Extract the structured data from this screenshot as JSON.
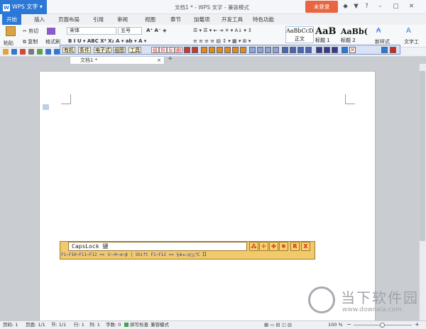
{
  "app": {
    "name": "WPS 文字",
    "doc_title": "文档1 * - WPS 文字 - 兼容模式",
    "login": "未登录"
  },
  "tabs": [
    "开始",
    "插入",
    "页面布局",
    "引用",
    "审阅",
    "视图",
    "章节",
    "加载项",
    "开发工具",
    "特色功能"
  ],
  "ribbon": {
    "paste": "粘贴",
    "cut": "剪切",
    "copy": "复制",
    "format_painter": "格式刷",
    "font_name": "宋体",
    "font_size": "五号",
    "styles": [
      {
        "preview": "AaBbCcD",
        "name": "正文"
      },
      {
        "preview": "AaB",
        "name": "标题 1"
      },
      {
        "preview": "AaBb(",
        "name": "标题 2"
      }
    ],
    "new_style": "新样式",
    "text_tools": "文字工"
  },
  "doc_tab": {
    "label": "文档1 *"
  },
  "ime_toolbar": {
    "buttons": [
      "有机",
      "条件",
      "电子式",
      "组图",
      "工具"
    ],
    "red_items": [
      "组",
      "拆",
      "反",
      "删"
    ]
  },
  "ime_candidate": {
    "input": "CapsLock 键",
    "hint": "F1~F10~F11~F12  => ①~⑩~α~β  |  Shift F1~F12 => §※★☆◎□△℃【】",
    "buttons": [
      "⁂",
      "✢",
      "✤",
      "❃",
      "R",
      "X"
    ]
  },
  "status": {
    "page": "页码: 1",
    "pages": "页面: 1/1",
    "section": "节: 1/1",
    "line": "行: 1",
    "column": "列: 1",
    "words": "字数: 0",
    "spellcheck": "拼写检查",
    "compat": "兼容模式",
    "zoom": "100 %"
  },
  "watermark": {
    "brand": "当下软件园",
    "url": "www.downxia.com"
  }
}
